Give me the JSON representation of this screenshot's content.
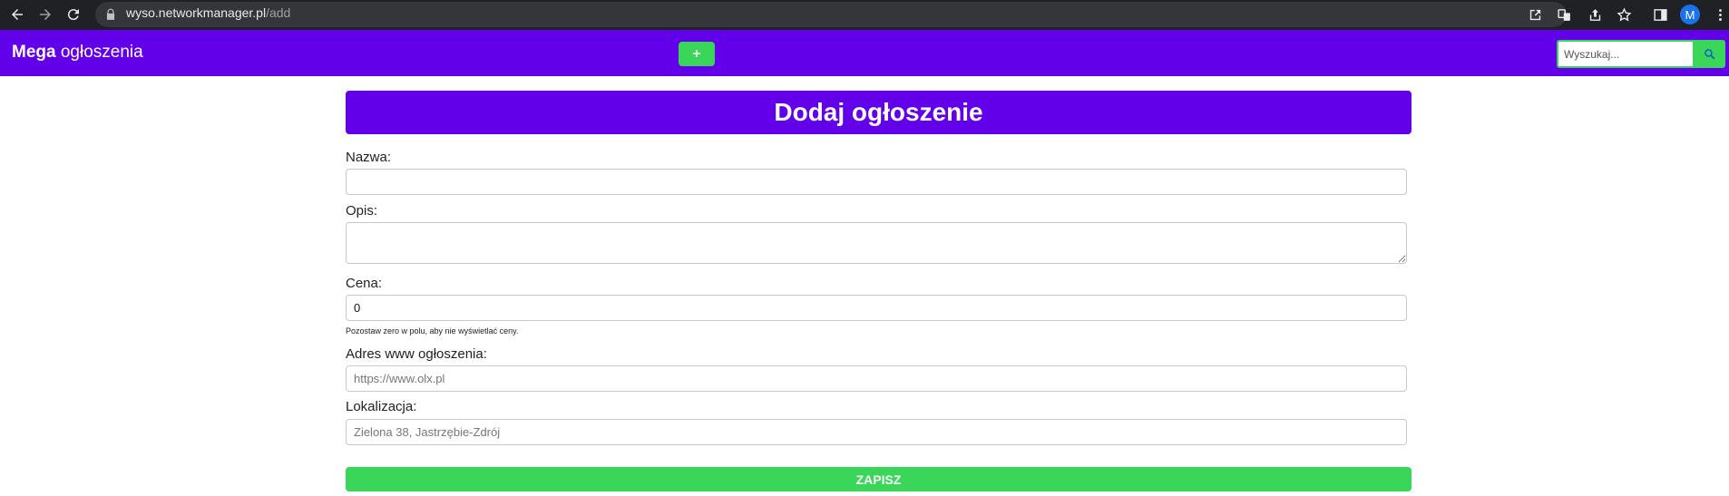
{
  "browser": {
    "url_host": "wyso.networkmanager.pl",
    "url_path": "/add",
    "profile_initial": "M",
    "icons": [
      "back-arrow-icon",
      "forward-arrow-icon",
      "reload-icon",
      "lock-icon",
      "install-icon",
      "translate-icon",
      "share-icon",
      "bookmark-star-icon",
      "side-panel-icon",
      "kebab-menu-icon"
    ]
  },
  "navbar": {
    "brand_bold": "Mega",
    "brand_rest": " ogłoszenia",
    "add_label": "+",
    "search_placeholder": "Wyszukaj...",
    "search_icon": "magnifier-icon"
  },
  "form": {
    "title": "Dodaj ogłoszenie",
    "fields": {
      "name": {
        "label": "Nazwa:",
        "value": ""
      },
      "description": {
        "label": "Opis:",
        "value": ""
      },
      "price": {
        "label": "Cena:",
        "value": "0",
        "hint": "Pozostaw zero w polu, aby nie wyświetlać ceny."
      },
      "url": {
        "label": "Adres www ogłoszenia:",
        "placeholder": "https://www.olx.pl"
      },
      "location": {
        "label": "Lokalizacja:",
        "placeholder": "Zielona 38, Jastrzębie-Zdrój"
      }
    },
    "submit_label": "ZAPISZ"
  },
  "colors": {
    "primary": "#6200ea",
    "accent": "#3ad65a",
    "chrome_bg": "#202124"
  }
}
